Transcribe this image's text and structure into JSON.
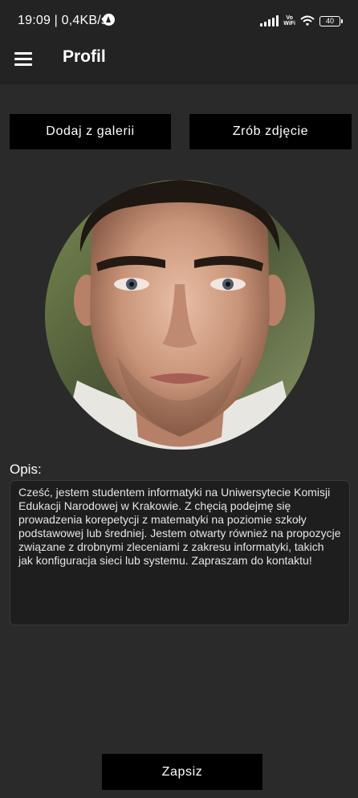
{
  "status_bar": {
    "time": "19:09 | 0,4KB/s",
    "vowifi_top": "Vo",
    "vowifi_bottom": "WiFi",
    "battery": "40"
  },
  "appbar": {
    "title": "Profil",
    "menu_icon": "hamburger-menu-icon"
  },
  "buttons": {
    "gallery": "Dodaj z galerii",
    "photo": "Zrób zdjęcie",
    "save": "Zapsiz"
  },
  "description": {
    "label": "Opis:",
    "text": "Cześć, jestem studentem informatyki na Uniwersytecie Komisji Edukacji Narodowej w Krakowie. Z chęcią podejmę się prowadzenia korepetycji z matematyki na poziomie szkoły podstawowej lub średniej. Jestem otwarty również na propozycje związane z drobnymi zleceniami z zakresu informatyki, takich jak konfiguracja sieci lub systemu. Zapraszam do kontaktu!"
  },
  "colors": {
    "background": "#2a2a2a",
    "appbar": "#232323",
    "button": "#000000",
    "text": "#ffffff"
  }
}
